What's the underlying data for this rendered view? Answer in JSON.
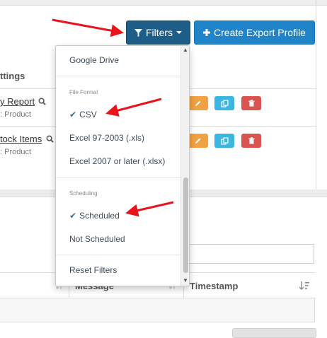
{
  "header": {
    "filters_label": "Filters",
    "create_label": "Create Export Profile"
  },
  "table1": {
    "heading_settings": "ttings",
    "rows": [
      {
        "name": "y Report",
        "sub": ": Product"
      },
      {
        "name": "tock Items",
        "sub": ": Product"
      }
    ]
  },
  "table2": {
    "columns": [
      "Message",
      "Timestamp"
    ]
  },
  "filters_menu": {
    "destination": "Google Drive",
    "file_format_header": "File Format",
    "formats": [
      "CSV",
      "Excel 97-2003 (.xls)",
      "Excel 2007 or later (.xlsx)"
    ],
    "scheduling_header": "Scheduling",
    "scheduling": [
      "Scheduled",
      "Not Scheduled"
    ],
    "reset": "Reset Filters"
  },
  "colors": {
    "filters_button": "#1f5d89",
    "create_button": "#2184c8",
    "annotation_arrows": "#e8141c",
    "edit": "#f0a142",
    "copy": "#3bb6e0",
    "delete": "#d9534f"
  }
}
